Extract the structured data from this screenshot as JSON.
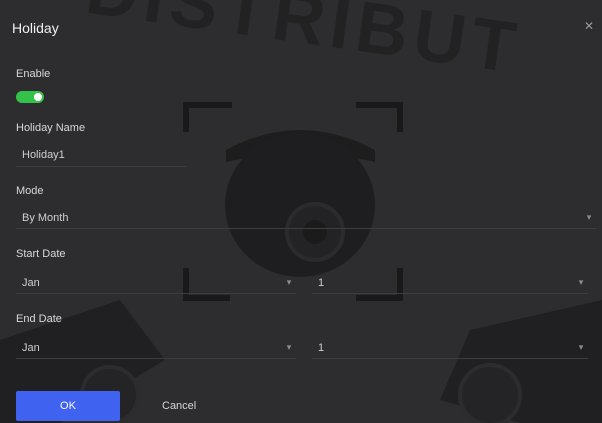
{
  "dialog": {
    "title": "Holiday",
    "close_icon": "close-icon"
  },
  "form": {
    "enable": {
      "label": "Enable",
      "value": true
    },
    "holiday_name": {
      "label": "Holiday Name",
      "value": "Holiday1"
    },
    "mode": {
      "label": "Mode",
      "value": "By Month"
    },
    "start_date": {
      "label": "Start Date",
      "month": "Jan",
      "day": "1"
    },
    "end_date": {
      "label": "End Date",
      "month": "Jan",
      "day": "1"
    }
  },
  "buttons": {
    "ok_label": "OK",
    "cancel_label": "Cancel"
  },
  "colors": {
    "accent": "#3f63f0",
    "toggle_on": "#35c24a",
    "background": "#2d2d2f"
  },
  "watermark": {
    "text": "DISTRIBUT"
  }
}
